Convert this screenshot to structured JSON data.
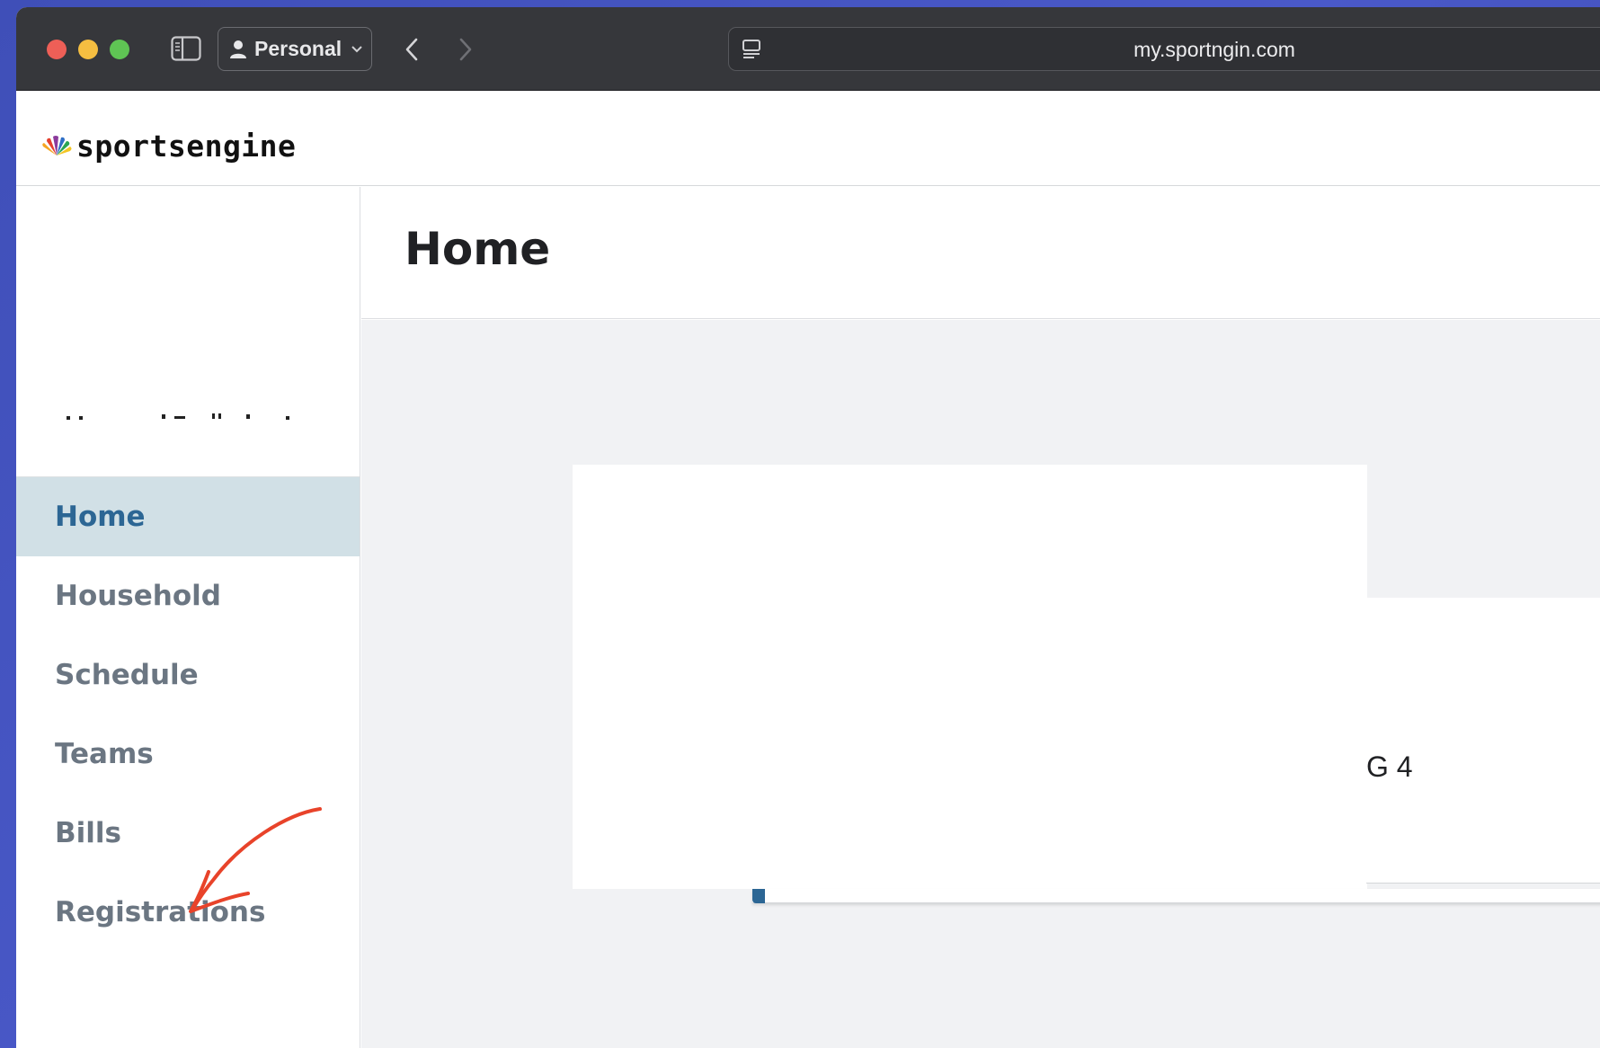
{
  "browser": {
    "profile_label": "Personal",
    "url": "my.sportngin.com"
  },
  "site": {
    "logo_text": "sportsengine"
  },
  "sidebar": {
    "items": [
      {
        "label": "Home",
        "active": true
      },
      {
        "label": "Household",
        "active": false
      },
      {
        "label": "Schedule",
        "active": false
      },
      {
        "label": "Teams",
        "active": false
      },
      {
        "label": "Bills",
        "active": false
      },
      {
        "label": "Registrations",
        "active": false
      }
    ]
  },
  "main": {
    "page_title": "Home",
    "partial_card_text": "G 4"
  },
  "colors": {
    "active_nav_bg": "#d1e0e6",
    "active_nav_text": "#2c6694",
    "nav_text": "#6b7682",
    "annotation_arrow": "#e8432a"
  }
}
